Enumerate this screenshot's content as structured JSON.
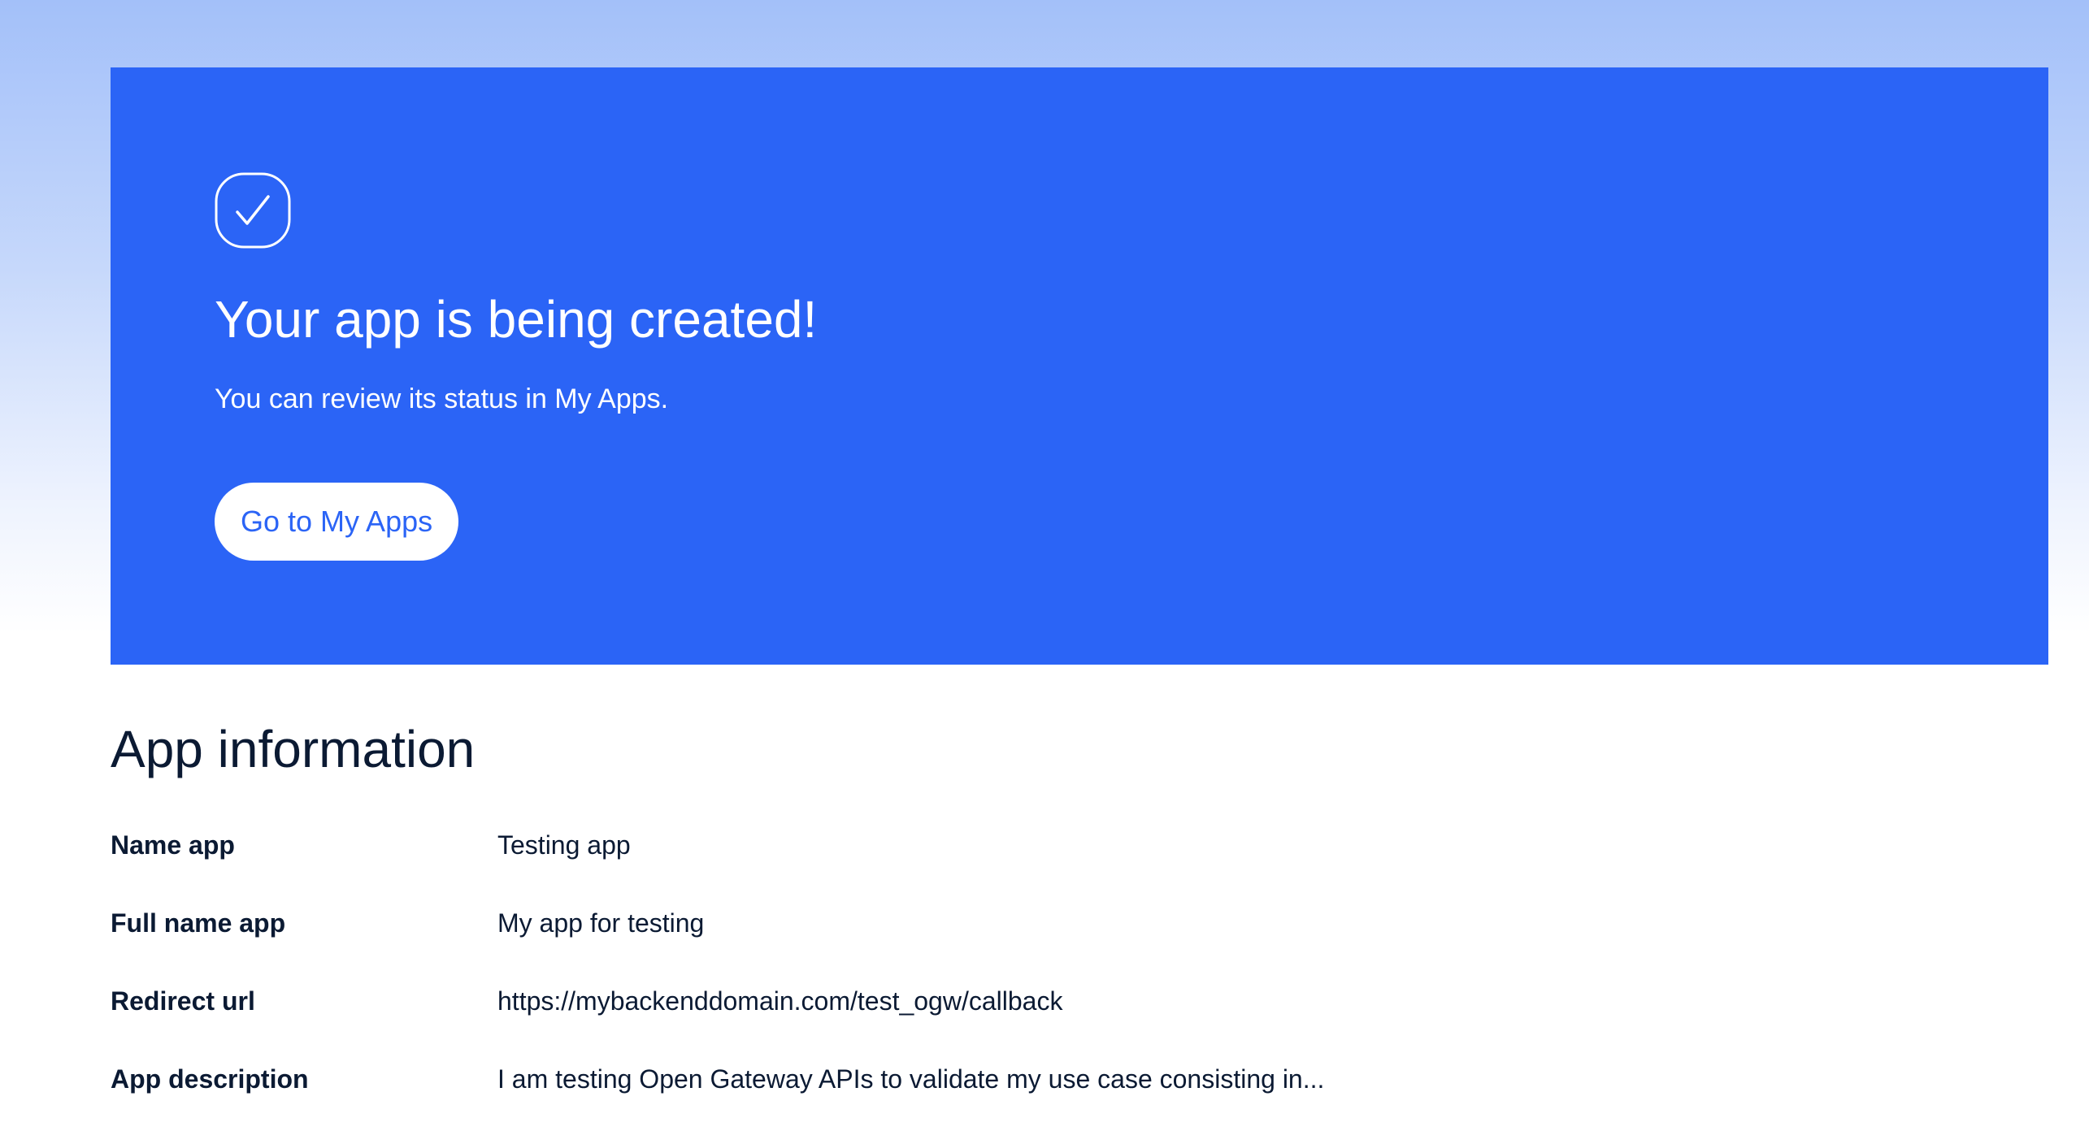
{
  "hero": {
    "icon": "check-badge-icon",
    "title": "Your app is being created!",
    "subtitle": "You can review its status in My Apps.",
    "button_label": "Go to My Apps",
    "background_color": "#2b64f6",
    "button_text_color": "#2b64f6"
  },
  "app_info": {
    "title": "App information",
    "rows": [
      {
        "label": "Name app",
        "value": "Testing app"
      },
      {
        "label": "Full name app",
        "value": "My app for testing"
      },
      {
        "label": "Redirect url",
        "value": "https://mybackenddomain.com/test_ogw/callback"
      },
      {
        "label": "App description",
        "value": "I am testing Open Gateway APIs to validate my use case consisting in..."
      }
    ]
  }
}
